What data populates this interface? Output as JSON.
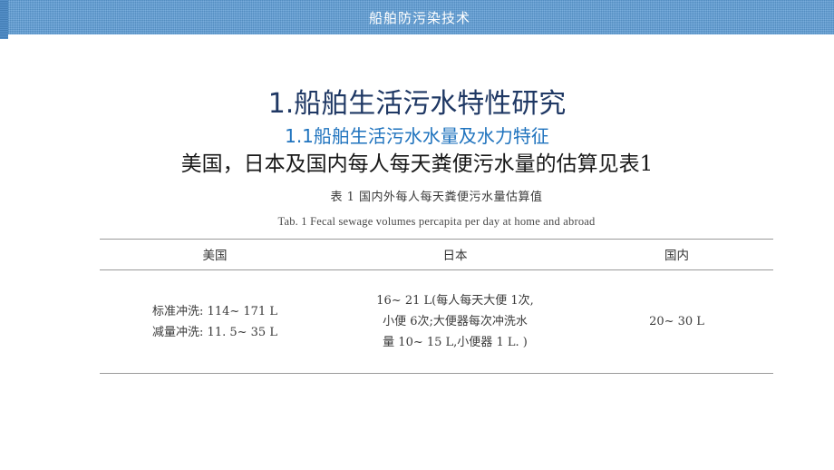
{
  "header": {
    "title": "船舶防污染技术",
    "bg_color": "#5b9bd5",
    "tab_color": "#4887c4",
    "text_color": "#ffffff"
  },
  "slide": {
    "main_title": "1.船舶生活污水特性研究",
    "main_title_color": "#1f3864",
    "sub_title": "1.1船舶生活污水水量及水力特征",
    "sub_title_color": "#1f73be",
    "lead_line": "美国，日本及国内每人每天粪便污水量的估算见表1"
  },
  "table_figure": {
    "caption_cn": "表 1  国内外每人每天粪便污水量估算值",
    "caption_en": "Tab. 1    Fecal sewage volumes percapita per day at home and abroad",
    "columns": [
      "美国",
      "日本",
      "国内"
    ],
    "rows": [
      {
        "us": [
          "标准冲洗: 114~ 171 L",
          "减量冲洗: 11. 5~ 35 L"
        ],
        "jp": [
          "16~ 21 L(每人每天大便 1次,",
          "小便 6次;大便器每次冲洗水",
          "量 10~ 15 L,小便器 1 L. )"
        ],
        "cn": [
          "20~ 30 L"
        ]
      }
    ]
  }
}
